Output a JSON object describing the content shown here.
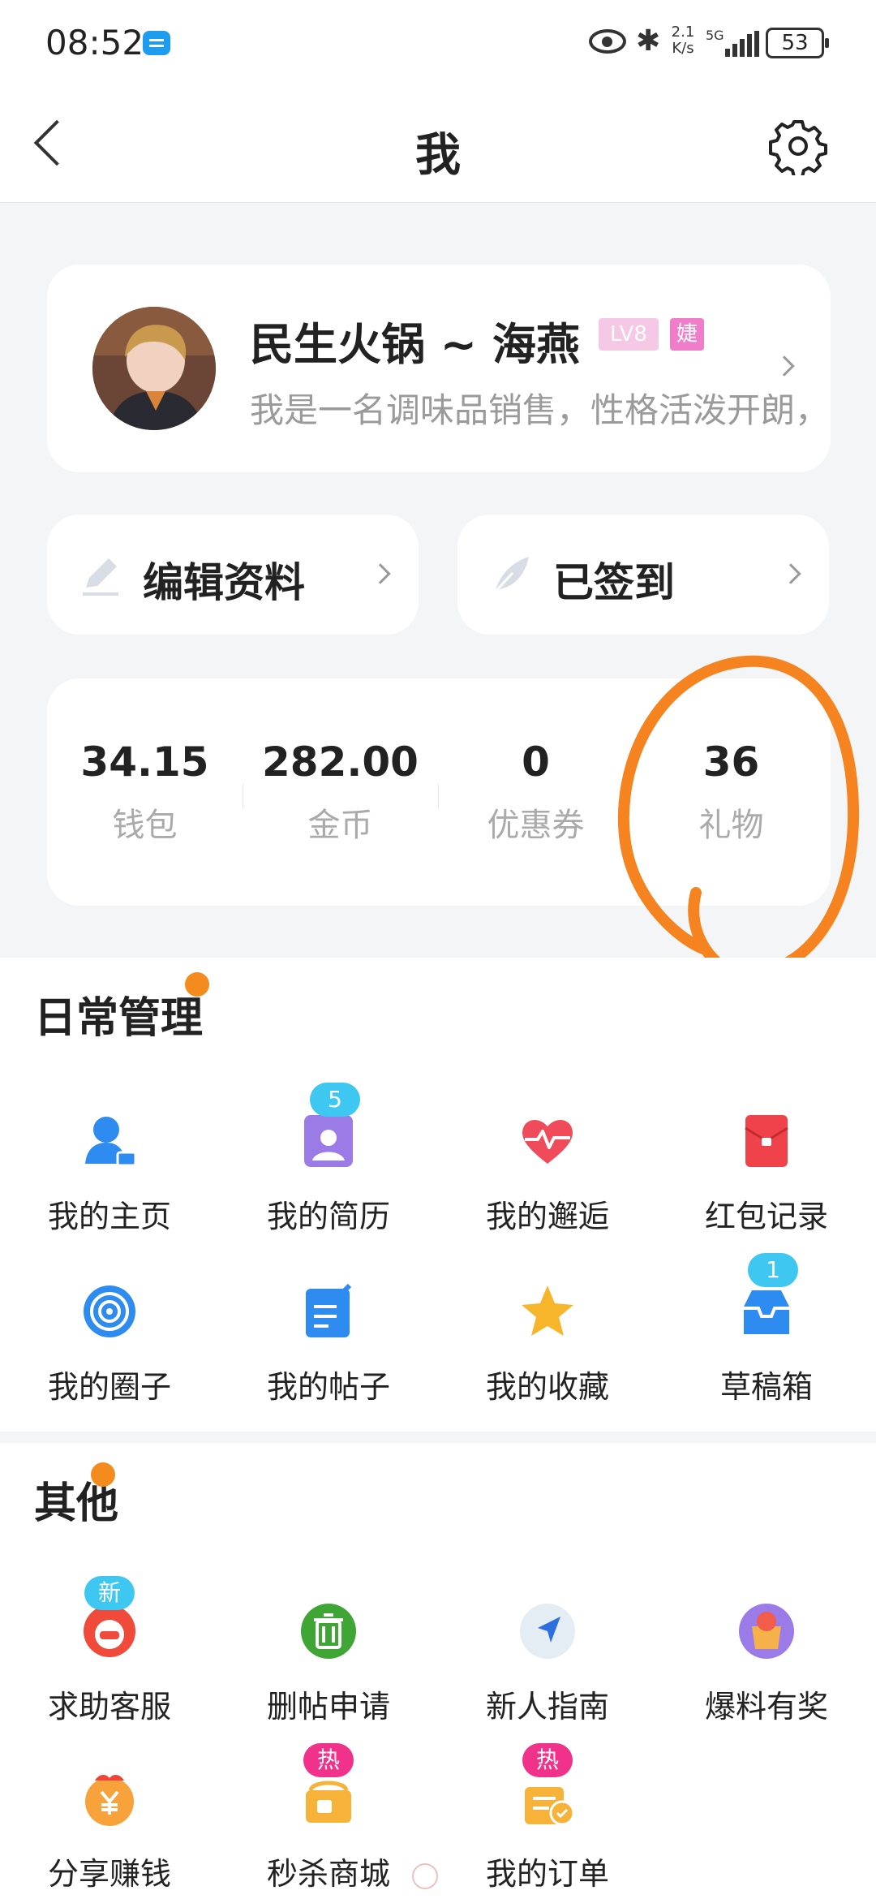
{
  "status_bar": {
    "time": "08:52",
    "network_speed": "2.1 K/s",
    "network_type": "5G",
    "battery": "53"
  },
  "nav": {
    "title": "我"
  },
  "profile": {
    "name": "民生火锅 ~ 海燕",
    "level_badge": "LV8",
    "gender_badge": "婕",
    "bio": "我是一名调味品销售，性格活泼开朗，"
  },
  "actions": {
    "edit_profile": "编辑资料",
    "signed_in": "已签到"
  },
  "stats": [
    {
      "value": "34.15",
      "label": "钱包"
    },
    {
      "value": "282.00",
      "label": "金币"
    },
    {
      "value": "0",
      "label": "优惠券"
    },
    {
      "value": "36",
      "label": "礼物"
    }
  ],
  "daily": {
    "title": "日常管理",
    "items": [
      {
        "label": "我的主页",
        "icon": "person-card-icon"
      },
      {
        "label": "我的简历",
        "icon": "resume-icon",
        "badge": "5"
      },
      {
        "label": "我的邂逅",
        "icon": "heart-pulse-icon"
      },
      {
        "label": "红包记录",
        "icon": "red-envelope-icon"
      },
      {
        "label": "我的圈子",
        "icon": "circle-target-icon"
      },
      {
        "label": "我的帖子",
        "icon": "post-edit-icon"
      },
      {
        "label": "我的收藏",
        "icon": "star-icon"
      },
      {
        "label": "草稿箱",
        "icon": "inbox-icon",
        "badge": "1"
      }
    ]
  },
  "other": {
    "title": "其他",
    "items": [
      {
        "label": "求助客服",
        "icon": "customer-service-icon",
        "badge": "新"
      },
      {
        "label": "删帖申请",
        "icon": "trash-icon"
      },
      {
        "label": "新人指南",
        "icon": "navigation-arrow-icon"
      },
      {
        "label": "爆料有奖",
        "icon": "gift-bag-icon"
      },
      {
        "label": "分享赚钱",
        "icon": "yen-coin-icon"
      },
      {
        "label": "秒杀商城",
        "icon": "shop-icon",
        "badge": "热"
      },
      {
        "label": "我的订单",
        "icon": "order-icon",
        "badge": "热"
      }
    ]
  },
  "colors": {
    "accent_blue": "#2e8cf0",
    "badge_blue": "#3ec7f0",
    "badge_pink": "#f0328a",
    "annotation_orange": "#f5831f",
    "dot_orange": "#f38b1f"
  }
}
